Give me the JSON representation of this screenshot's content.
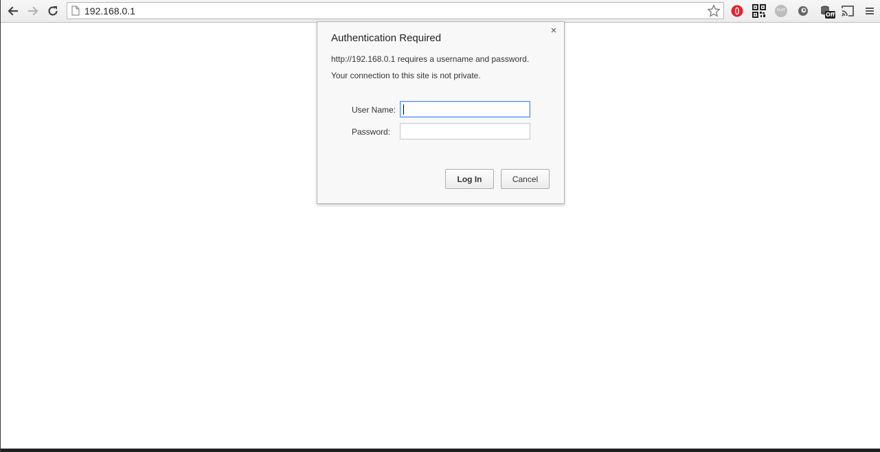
{
  "browser": {
    "url": "192.168.0.1",
    "icons": {
      "back": "back-arrow-icon",
      "forward": "forward-arrow-icon",
      "reload": "reload-icon",
      "page": "page-icon",
      "bookmark": "star-icon",
      "menu": "hamburger-menu-icon"
    },
    "extensions": [
      "opera-icon",
      "qr-code-icon",
      "flat-icon",
      "eye-icon",
      "off-extension-icon",
      "cast-icon"
    ],
    "extension_flat_label": "FLAT",
    "extension_off_label": "Off"
  },
  "dialog": {
    "title": "Authentication Required",
    "message_line1": "http://192.168.0.1 requires a username and password.",
    "message_line2": "Your connection to this site is not private.",
    "username_label": "User Name:",
    "username_value": "",
    "password_label": "Password:",
    "password_value": "",
    "login_label": "Log In",
    "cancel_label": "Cancel",
    "close_glyph": "×"
  },
  "colors": {
    "focus_border": "#4d90fe",
    "opera_red": "#e0232c"
  }
}
